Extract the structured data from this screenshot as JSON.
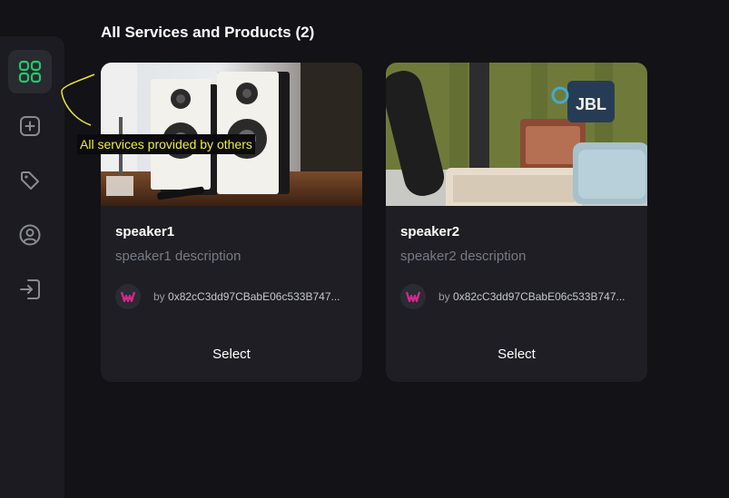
{
  "sidebar": {
    "items": [
      {
        "icon": "grid-icon",
        "active": true
      },
      {
        "icon": "plus-square-icon",
        "active": false
      },
      {
        "icon": "tag-icon",
        "active": false
      },
      {
        "icon": "user-circle-icon",
        "active": false
      },
      {
        "icon": "login-icon",
        "active": false
      }
    ]
  },
  "main": {
    "title": "All Services and Products (2)",
    "cards": [
      {
        "name": "speaker1",
        "description": "speaker1 description",
        "author_prefix": "by",
        "author_address": "0x82cC3dd97CBabE06c533B747...",
        "select_label": "Select"
      },
      {
        "name": "speaker2",
        "description": "speaker2 description",
        "author_prefix": "by",
        "author_address": "0x82cC3dd97CBabE06c533B747...",
        "select_label": "Select"
      }
    ]
  },
  "tooltip": {
    "text": "All services provided by others"
  },
  "colors": {
    "accent": "#23c96b",
    "tooltip_text": "#ecec3c",
    "background": "#121217",
    "card": "#1e1e24"
  }
}
